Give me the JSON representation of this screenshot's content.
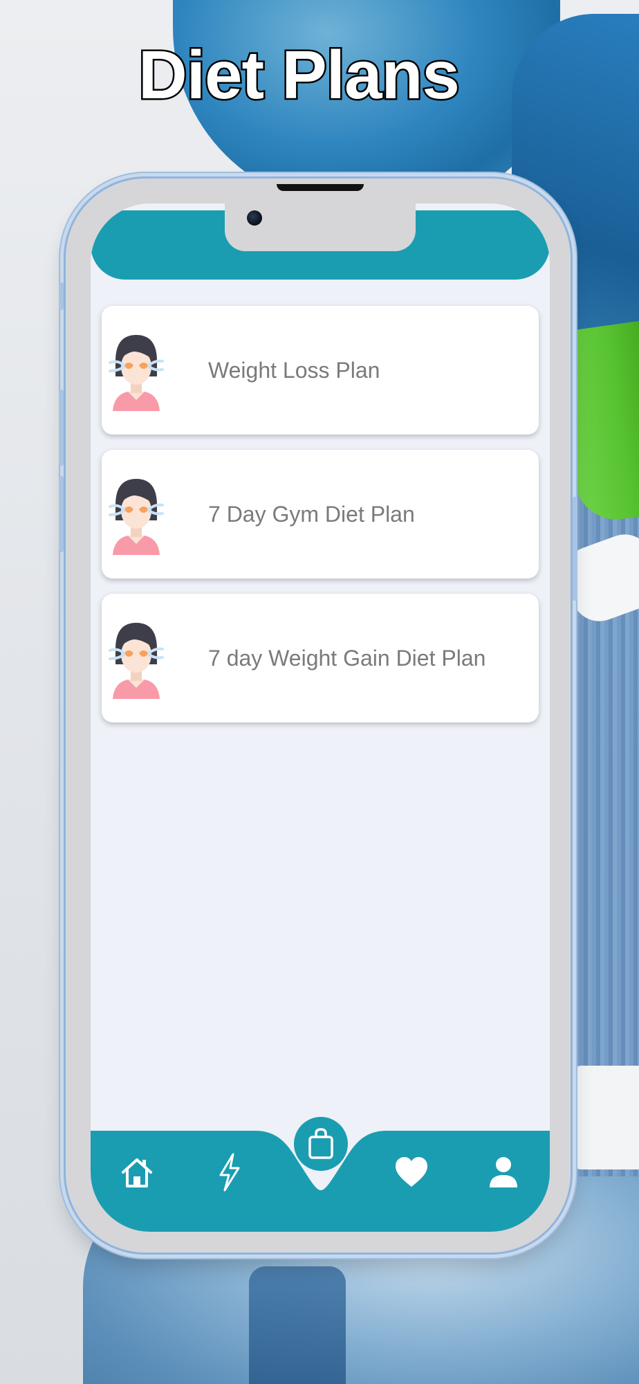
{
  "headline": "Diet Plans",
  "colors": {
    "accent": "#1a9db1",
    "card_text": "#7a7a7a",
    "screen_bg": "#eef1f7"
  },
  "plans": [
    {
      "label": "Weight Loss Plan",
      "icon": "woman-avatar-icon"
    },
    {
      "label": "7 Day Gym Diet Plan",
      "icon": "woman-avatar-icon"
    },
    {
      "label": "7 day Weight Gain Diet Plan",
      "icon": "woman-avatar-icon"
    }
  ],
  "bottom_nav": {
    "items": [
      "home-icon",
      "lightning-icon",
      "shopping-bag-icon",
      "heart-icon",
      "user-icon"
    ],
    "active": "shopping-bag-icon"
  }
}
